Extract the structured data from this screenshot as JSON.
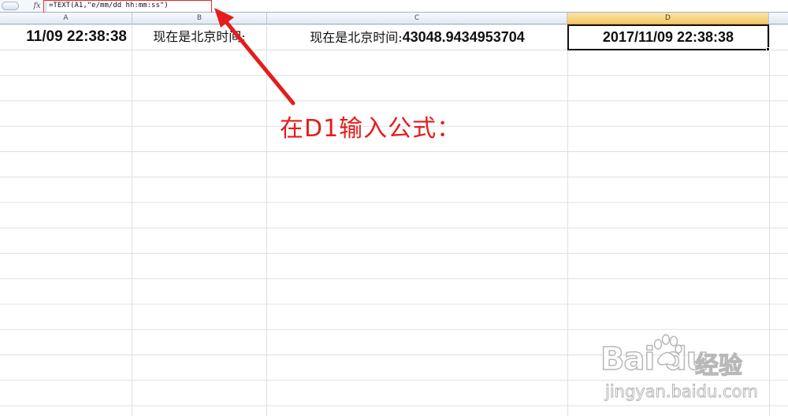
{
  "formula_bar": {
    "fx_label": "fx",
    "formula": "=TEXT(A1,\"e/mm/dd hh:mm:ss\")"
  },
  "columns": [
    {
      "label": "A",
      "selected": false
    },
    {
      "label": "B",
      "selected": false
    },
    {
      "label": "C",
      "selected": false
    },
    {
      "label": "D",
      "selected": true
    }
  ],
  "row1": {
    "a": "11/09 22:38:38",
    "b": "现在是北京时间:",
    "c_prefix": "现在是北京时间:",
    "c_number": "43048.9434953704",
    "d": "2017/11/09 22:38:38"
  },
  "annotation": {
    "text": "在D1输入公式：",
    "color": "#e51c1c"
  },
  "watermark": {
    "logo": "Bai du",
    "brand": "经验",
    "url": "jingyan.baidu.com"
  },
  "colors": {
    "selected_header": "#f5c766",
    "grid_line": "#dbe0e7",
    "highlight": "#e52b2b"
  }
}
